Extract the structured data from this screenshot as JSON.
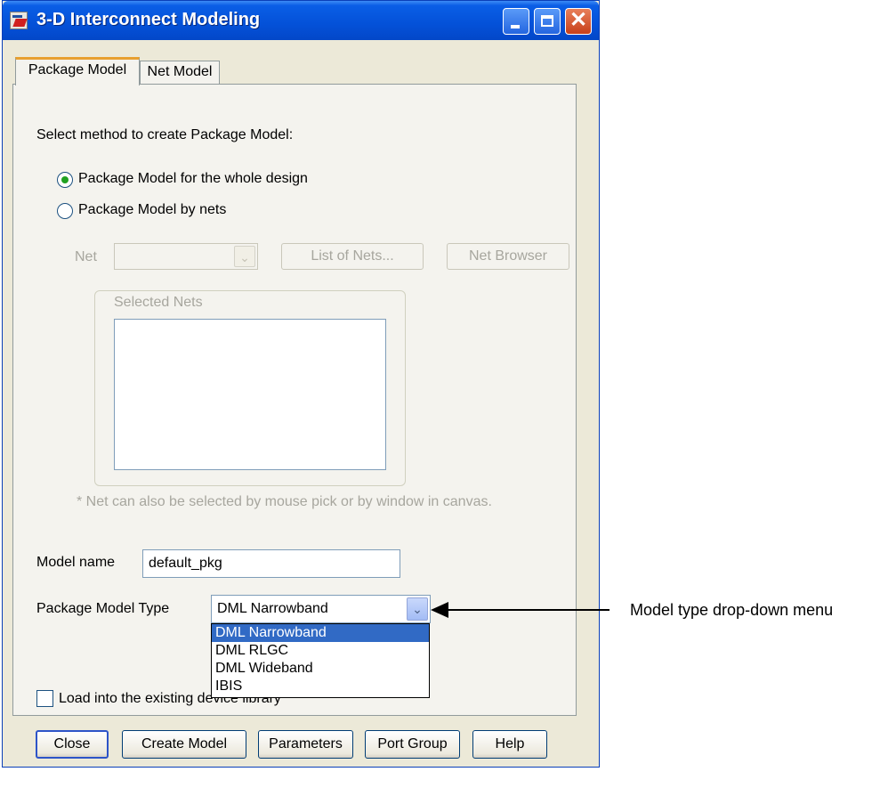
{
  "window": {
    "title": "3-D Interconnect Modeling",
    "controls": {
      "minimize": "minimize-icon",
      "maximize": "maximize-icon",
      "close_glyph": "✕"
    }
  },
  "tabs": [
    {
      "label": "Package Model",
      "active": true
    },
    {
      "label": "Net Model",
      "active": false
    }
  ],
  "method": {
    "prompt": "Select method to create Package Model:",
    "options": [
      {
        "label": "Package Model for the whole design",
        "checked": true
      },
      {
        "label": "Package Model by nets",
        "checked": false
      }
    ]
  },
  "net": {
    "label": "Net",
    "value": "",
    "list_button": "List of Nets...",
    "browser_button": "Net Browser",
    "selected_group": "Selected Nets",
    "note": "* Net can also be selected by mouse pick or by window in canvas."
  },
  "model_name": {
    "label": "Model name",
    "value": "default_pkg"
  },
  "model_type": {
    "label": "Package Model Type",
    "value": "DML Narrowband",
    "options": [
      "DML Narrowband",
      "DML RLGC",
      "DML Wideband",
      "IBIS"
    ],
    "selected_index": 0
  },
  "load_library": {
    "label": "Load into the existing device library",
    "checked": false
  },
  "buttons": {
    "close": "Close",
    "create": "Create Model",
    "parameters": "Parameters",
    "port_group": "Port Group",
    "help": "Help"
  },
  "annotation": "Model type drop-down menu",
  "colors": {
    "titlebar": "#0451d8",
    "selection": "#316ac5",
    "dialog_bg": "#ece9d8"
  }
}
